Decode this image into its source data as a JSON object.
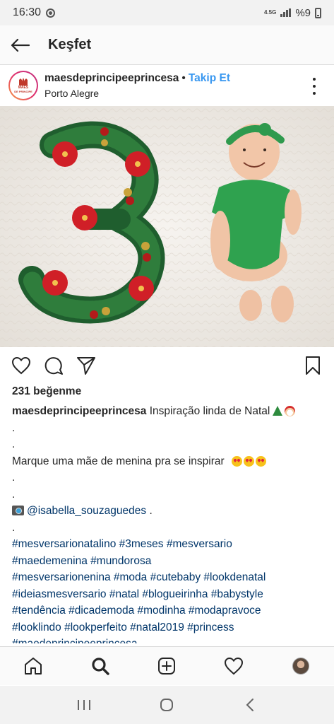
{
  "status_bar": {
    "time": "16:30",
    "network": "4.5G",
    "battery": "%9"
  },
  "header": {
    "title": "Keşfet"
  },
  "post": {
    "username": "maesdeprincipeeprincesa",
    "separator": "•",
    "follow_label": "Takip Et",
    "location": "Porto Alegre",
    "avatar_text": [
      "MAES",
      "DE PRINCIPE",
      "PRINCESA"
    ],
    "likes": "231 beğenme"
  },
  "caption": {
    "username": "maesdeprincipeeprincesa",
    "first_text": " Inspiração linda de Natal",
    "dot": ".",
    "cta": "Marque uma mãe de menina pra se inspirar",
    "credit": "@isabella_souzaguedes",
    "credit_suffix": " .",
    "hashtag_lines": [
      "#mesversarionatalino #3meses #mesversario",
      "#maedemenina #mundorosa",
      "#mesversarionenina #moda #cutebaby  #lookdenatal",
      "#ideiasmesversario #natal #blogueirinha #babystyle",
      "#tendência #dicademoda #modinha #modapravoce",
      "#looklindo #lookperfeito #natal2019 #princess",
      "#maedeprincipeeprincesa"
    ]
  },
  "icons": {
    "back": "arrow-left-icon",
    "more": "more-vertical-icon",
    "like": "heart-icon",
    "comment": "comment-icon",
    "share": "paper-plane-icon",
    "save": "bookmark-icon",
    "home": "home-icon",
    "search": "search-icon",
    "add": "plus-square-icon",
    "activity": "heart-icon"
  },
  "colors": {
    "link_blue": "#3897f0",
    "hashtag": "#003569",
    "text": "#262626"
  }
}
